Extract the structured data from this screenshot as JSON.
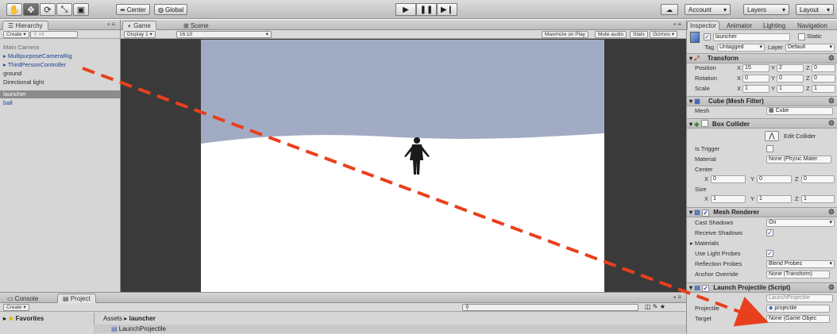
{
  "toolbar": {
    "center_label": "Center",
    "global_label": "Global",
    "account_label": "Account",
    "layers_label": "Layers",
    "layout_label": "Layout"
  },
  "hierarchy": {
    "tab_label": "Hierarchy",
    "create_label": "Create",
    "search_placeholder": "All",
    "items": [
      {
        "label": "Main Camera"
      },
      {
        "label": "MultipurposeCameraRig"
      },
      {
        "label": "ThirdPersonController"
      },
      {
        "label": "ground"
      },
      {
        "label": "Directional light"
      },
      {
        "label": "launcher"
      },
      {
        "label": "ball"
      }
    ]
  },
  "game": {
    "tab_game": "Game",
    "tab_scene": "Scene",
    "display_label": "Display 1",
    "aspect_label": "16:10",
    "maximize_label": "Maximize on Play",
    "mute_label": "Mute audio",
    "stats_label": "Stats",
    "gizmos_label": "Gizmos"
  },
  "inspector": {
    "tabs": [
      "Inspector",
      "Animator",
      "Lighting",
      "Navigation"
    ],
    "object_name": "launcher",
    "static_label": "Static",
    "tag_label": "Tag",
    "tag_value": "Untagged",
    "layer_label": "Layer",
    "layer_value": "Default",
    "transform": {
      "title": "Transform",
      "position_label": "Position",
      "rotation_label": "Rotation",
      "scale_label": "Scale",
      "position": [
        "15",
        "2",
        "0"
      ],
      "rotation": [
        "0",
        "0",
        "0"
      ],
      "scale": [
        "1",
        "1",
        "1"
      ]
    },
    "mesh_filter": {
      "title": "Cube (Mesh Filter)",
      "mesh_label": "Mesh",
      "mesh_value": "Cube"
    },
    "box_collider": {
      "title": "Box Collider",
      "edit_label": "Edit Collider",
      "is_trigger_label": "Is Trigger",
      "material_label": "Material",
      "material_value": "None (Physic Mater",
      "center_label": "Center",
      "center": [
        "0",
        "0",
        "0"
      ],
      "size_label": "Size",
      "size": [
        "1",
        "1",
        "1"
      ]
    },
    "mesh_renderer": {
      "title": "Mesh Renderer",
      "cast_shadows_label": "Cast Shadows",
      "cast_shadows_value": "On",
      "receive_shadows_label": "Receive Shadows",
      "materials_label": "Materials",
      "use_light_probes_label": "Use Light Probes",
      "reflection_probes_label": "Reflection Probes",
      "reflection_probes_value": "Blend Probes",
      "anchor_override_label": "Anchor Override",
      "anchor_override_value": "None (Transform)"
    },
    "launch_projectile": {
      "title": "Launch Projectile (Script)",
      "script_value": "LaunchProjectile",
      "projectile_label": "Projectile",
      "projectile_value": "projectile",
      "target_label": "Target",
      "target_value": "None (Game Objec"
    }
  },
  "bottom": {
    "tab_console": "Console",
    "tab_project": "Project",
    "create_label": "Create",
    "favorites_label": "Favorites",
    "breadcrumb_assets": "Assets",
    "breadcrumb_folder": "launcher",
    "file_label": "LaunchProjectile"
  },
  "colors": {
    "sky": "#a1abc3",
    "ground": "#ffffff",
    "arrow": "#e8401c",
    "prefab_text": "#1d3f9a"
  }
}
